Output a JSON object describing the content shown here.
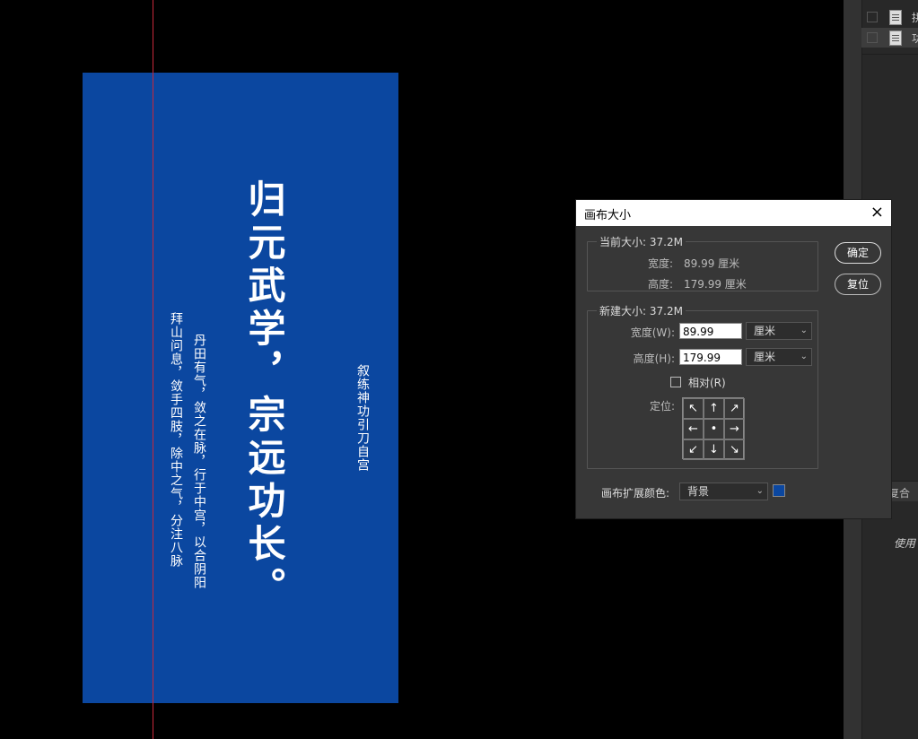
{
  "artwork": {
    "title": "归元武学，宗远功长。",
    "line_1": "拜山问息，敛手四肢，除中之气，分注八脉",
    "line_2": "丹田有气，敛之在脉，行于中宫，以合阴阳",
    "signature": "叙练神功引刀自宫",
    "background_color": "#0b47a0"
  },
  "layers_panel": {
    "rows": [
      {
        "name": "拼"
      },
      {
        "name": "功"
      }
    ],
    "tab_label": "复合",
    "info_text": "使用"
  },
  "dialog": {
    "title": "画布大小",
    "close_icon": "×",
    "current_size": {
      "legend": "当前大小: 37.2M",
      "width_label": "宽度:",
      "width_value": "89.99 厘米",
      "height_label": "高度:",
      "height_value": "179.99 厘米"
    },
    "new_size": {
      "legend": "新建大小: 37.2M",
      "width_label": "宽度(W):",
      "width_value": "89.99",
      "width_unit": "厘米",
      "height_label": "高度(H):",
      "height_value": "179.99",
      "height_unit": "厘米",
      "relative_label": "相对(R)",
      "relative_checked": false,
      "anchor_label": "定位:",
      "anchor_arrows": [
        "↖",
        "↑",
        "↗",
        "←",
        "•",
        "→",
        "↙",
        "↓",
        "↘"
      ]
    },
    "extension_label": "画布扩展颜色:",
    "extension_value": "背景",
    "extension_color": "#0b47a0",
    "ok_button": "确定",
    "reset_button": "复位"
  }
}
